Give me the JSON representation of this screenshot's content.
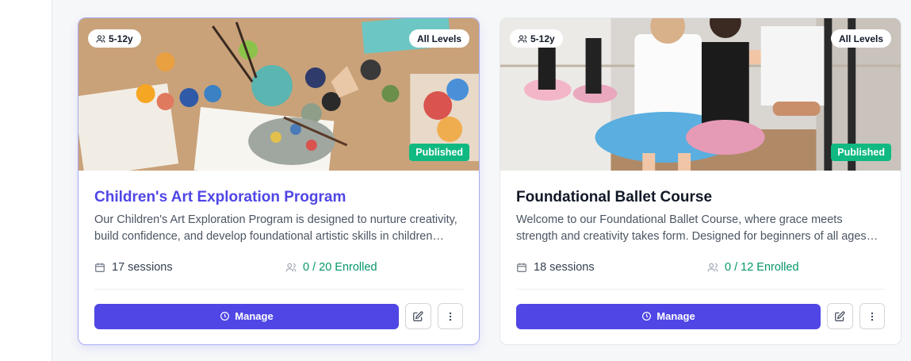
{
  "cards": [
    {
      "age_range": "5-12y",
      "level": "All Levels",
      "status": "Published",
      "title": "Children's Art Exploration Program",
      "description": "Our Children's Art Exploration Program is designed to nurture creativity, build confidence, and develop foundational artistic skills in children through hands-on projects and guided exploration.",
      "sessions": "17 sessions",
      "enrolled": "0 / 20 Enrolled",
      "manage_label": "Manage"
    },
    {
      "age_range": "5-12y",
      "level": "All Levels",
      "status": "Published",
      "title": "Foundational Ballet Course",
      "description": "Welcome to our Foundational Ballet Course, where grace meets strength and creativity takes form. Designed for beginners of all ages and abilities.",
      "sessions": "18 sessions",
      "enrolled": "0 / 12 Enrolled",
      "manage_label": "Manage"
    }
  ],
  "colors": {
    "primary": "#4f46e5",
    "published": "#10b981",
    "enrolled": "#059669"
  }
}
